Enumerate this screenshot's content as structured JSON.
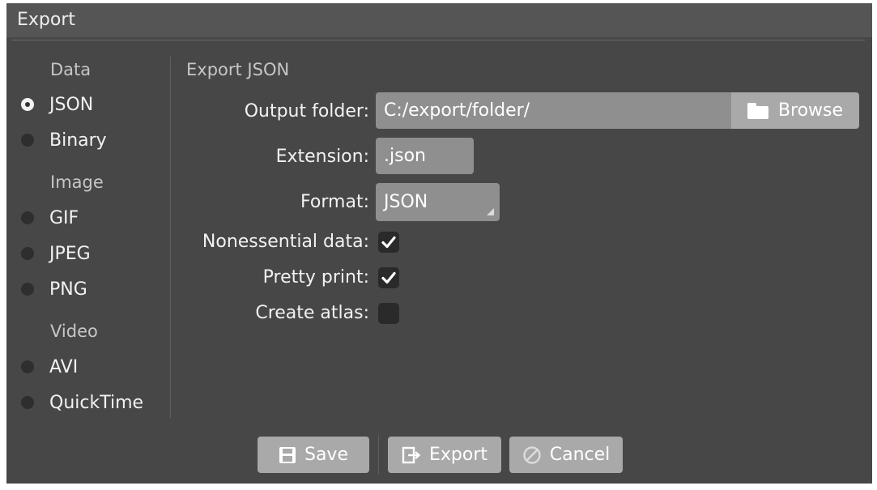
{
  "window": {
    "title": "Export"
  },
  "sidebar": {
    "groups": [
      {
        "header": "Data",
        "items": [
          {
            "label": "JSON",
            "selected": true
          },
          {
            "label": "Binary",
            "selected": false
          }
        ]
      },
      {
        "header": "Image",
        "items": [
          {
            "label": "GIF",
            "selected": false
          },
          {
            "label": "JPEG",
            "selected": false
          },
          {
            "label": "PNG",
            "selected": false
          }
        ]
      },
      {
        "header": "Video",
        "items": [
          {
            "label": "AVI",
            "selected": false
          },
          {
            "label": "QuickTime",
            "selected": false
          }
        ]
      }
    ]
  },
  "panel": {
    "title": "Export JSON",
    "output_folder": {
      "label": "Output folder:",
      "value": "C:/export/folder/",
      "browse_label": "Browse",
      "browse_icon": "folder-icon"
    },
    "extension": {
      "label": "Extension:",
      "value": ".json"
    },
    "format": {
      "label": "Format:",
      "value": "JSON"
    },
    "nonessential_data": {
      "label": "Nonessential data:",
      "checked": true
    },
    "pretty_print": {
      "label": "Pretty print:",
      "checked": true
    },
    "create_atlas": {
      "label": "Create atlas:",
      "checked": false
    }
  },
  "buttons": {
    "save": {
      "label": "Save",
      "icon": "save-icon"
    },
    "export": {
      "label": "Export",
      "icon": "export-icon"
    },
    "cancel": {
      "label": "Cancel",
      "icon": "cancel-icon"
    }
  },
  "colors": {
    "background": "#474747",
    "titlebar": "#555555",
    "field": "#8f8f8f",
    "button": "#a9a9a9",
    "checkbox": "#2a2a2a",
    "text": "#f2f2f2",
    "muted_text": "#c6c6c6"
  }
}
